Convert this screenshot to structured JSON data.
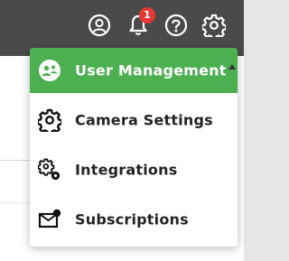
{
  "topbar": {
    "icons": [
      "account-icon",
      "bell-icon",
      "help-icon",
      "gear-icon"
    ],
    "notification_count": "1",
    "colors": {
      "background": "#4a4a4a",
      "badge": "#e53935"
    }
  },
  "menu": {
    "items": [
      {
        "label": "User Management",
        "icon": "user-management-icon",
        "active": true
      },
      {
        "label": "Camera Settings",
        "icon": "gear-icon",
        "active": false
      },
      {
        "label": "Integrations",
        "icon": "integrations-icon",
        "active": false
      },
      {
        "label": "Subscriptions",
        "icon": "subscriptions-icon",
        "active": false
      }
    ],
    "colors": {
      "active_background": "#4caf50",
      "active_text": "#ffffff",
      "text": "#222222"
    }
  }
}
